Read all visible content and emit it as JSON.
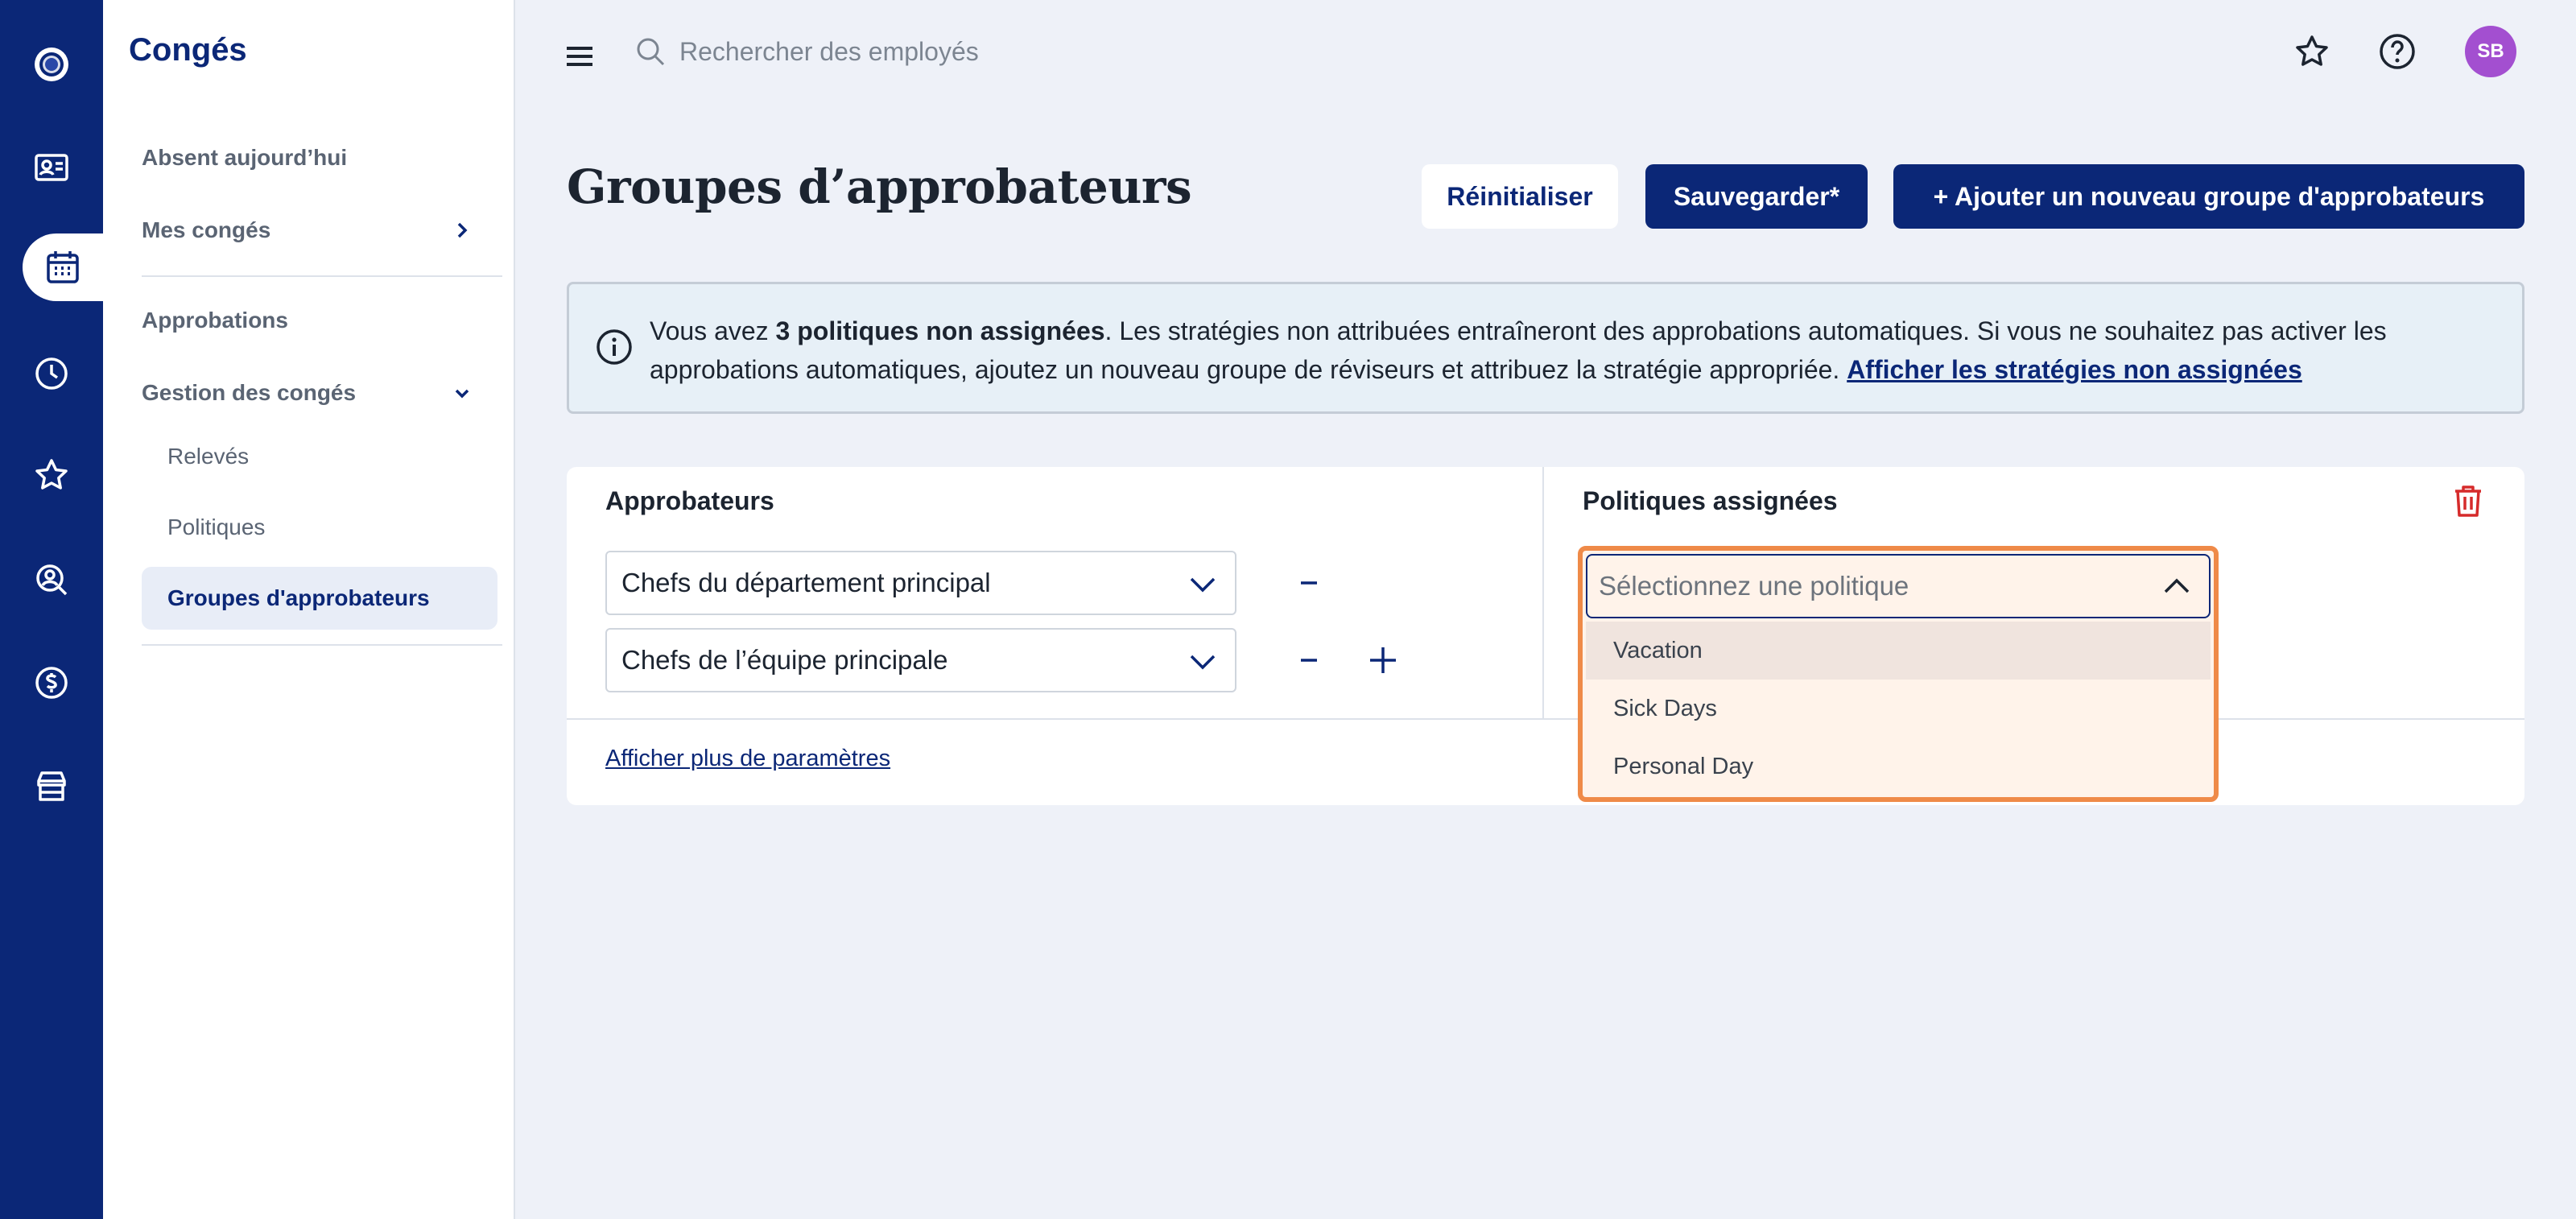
{
  "app": {
    "section_title": "Congés",
    "search": {
      "placeholder": "Rechercher des employés",
      "value": ""
    },
    "user": {
      "initials": "SB",
      "avatar_color": "#a34fd0"
    },
    "colors": {
      "brand": "#0b2777",
      "danger": "#d62b2b",
      "highlight": "#ef8a48"
    }
  },
  "rail": {
    "icons": [
      "logo-icon",
      "contact-card-icon",
      "calendar-icon",
      "clock-icon",
      "star-icon",
      "search-person-icon",
      "dollar-icon",
      "store-icon"
    ],
    "active": "calendar-icon"
  },
  "sidebar": {
    "items": [
      {
        "label": "Absent aujourd’hui"
      },
      {
        "label": "Mes congés"
      },
      {
        "label": "Approbations"
      },
      {
        "label": "Gestion des congés"
      }
    ],
    "sub_items": [
      {
        "label": "Relevés"
      },
      {
        "label": "Politiques"
      },
      {
        "label": "Groupes d'approbateurs",
        "active": true
      }
    ]
  },
  "header": {
    "title": "Groupes d’approbateurs",
    "reset_label": "Réinitialiser",
    "save_label": "Sauvegarder*",
    "add_label": "+ Ajouter un nouveau groupe d'approbateurs"
  },
  "banner": {
    "prefix": "Vous avez ",
    "bold": "3 politiques non assignées",
    "text": ". Les stratégies non attribuées entraîneront des approbations automatiques. Si vous ne souhaitez pas activer les approbations automatiques, ajoutez un nouveau groupe de réviseurs et attribuez la stratégie appropriée. ",
    "link": "Afficher les stratégies non assignées"
  },
  "card": {
    "approvers_header": "Approbateurs",
    "policies_header": "Politiques assignées",
    "approvers": [
      {
        "value": "Chefs du département principal"
      },
      {
        "value": "Chefs de l’équipe principale"
      }
    ],
    "policy_select": {
      "placeholder": "Sélectionnez une politique",
      "options": [
        "Vacation",
        "Sick Days",
        "Personal Day"
      ],
      "hovered": "Vacation"
    },
    "more_settings_link": "Afficher plus de paramètres"
  }
}
